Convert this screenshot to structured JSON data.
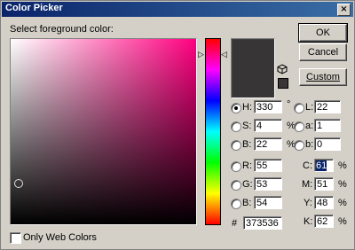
{
  "window": {
    "title": "Color Picker",
    "close_glyph": "×"
  },
  "labels": {
    "select_color": "Select foreground color:",
    "only_web": "Only Web Colors",
    "hex_prefix": "#"
  },
  "buttons": {
    "ok": "OK",
    "cancel": "Cancel",
    "custom": "Custom"
  },
  "current_color": "#373536",
  "hsb": {
    "h": {
      "label": "H:",
      "value": "330",
      "unit": "°"
    },
    "s": {
      "label": "S:",
      "value": "4",
      "unit": "%"
    },
    "b": {
      "label": "B:",
      "value": "22",
      "unit": "%"
    }
  },
  "lab": {
    "l": {
      "label": "L:",
      "value": "22"
    },
    "a": {
      "label": "a:",
      "value": "1"
    },
    "b": {
      "label": "b:",
      "value": "0"
    }
  },
  "rgb": {
    "r": {
      "label": "R:",
      "value": "55"
    },
    "g": {
      "label": "G:",
      "value": "53"
    },
    "b": {
      "label": "B:",
      "value": "54"
    }
  },
  "cmyk": {
    "c": {
      "label": "C:",
      "value": "61",
      "unit": "%"
    },
    "m": {
      "label": "M:",
      "value": "51",
      "unit": "%"
    },
    "y": {
      "label": "Y:",
      "value": "48",
      "unit": "%"
    },
    "k": {
      "label": "K:",
      "value": "62",
      "unit": "%"
    }
  },
  "hex": "373536",
  "icons": {
    "cube": "cube-icon",
    "gamut": "gamut-warning-icon"
  }
}
